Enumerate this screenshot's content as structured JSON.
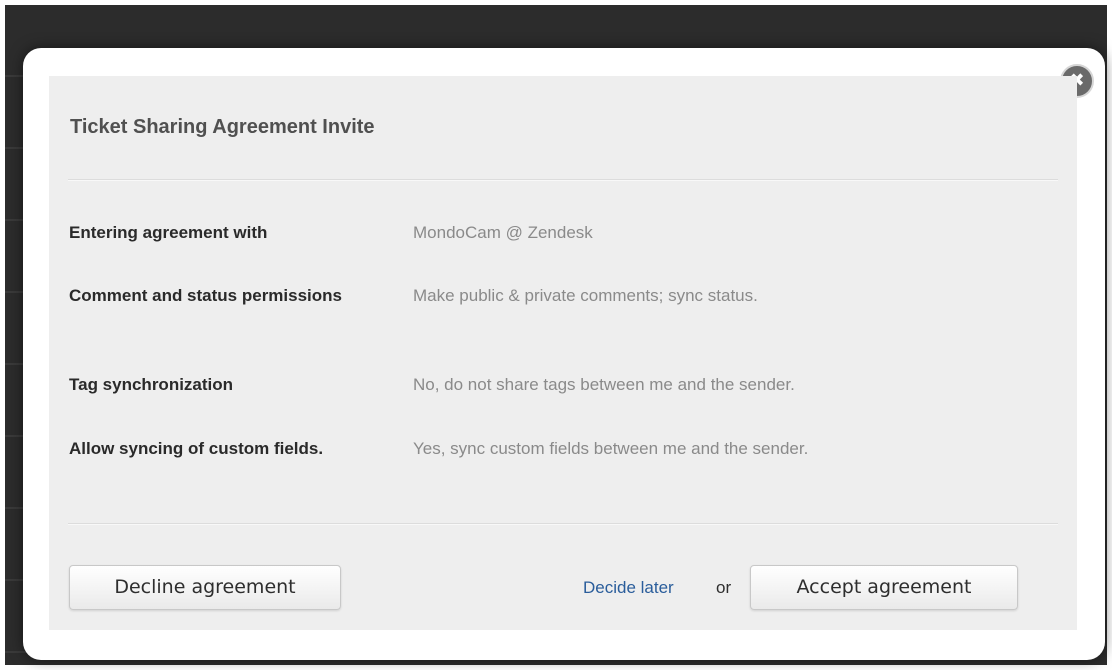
{
  "modal": {
    "title": "Ticket Sharing Agreement Invite",
    "close_icon": "close-icon",
    "close_glyph": "✖",
    "rows": [
      {
        "label": "Entering agreement with",
        "value": "MondoCam @ Zendesk"
      },
      {
        "label": "Comment and status permissions",
        "value": "Make public & private comments; sync status."
      },
      {
        "label": "Tag synchronization",
        "value": "No, do not share tags between me and the sender."
      },
      {
        "label": "Allow syncing of custom fields.",
        "value": "Yes, sync custom fields between me and the sender."
      }
    ],
    "actions": {
      "decline_label": "Decline agreement",
      "decide_later_label": "Decide later",
      "or_text": "or",
      "accept_label": "Accept agreement"
    }
  },
  "colors": {
    "backdrop": "#2c2c2c",
    "panel": "#eeeeee",
    "link": "#2a5d9b",
    "label": "#2a2a2a",
    "value": "#8a8a8a"
  }
}
